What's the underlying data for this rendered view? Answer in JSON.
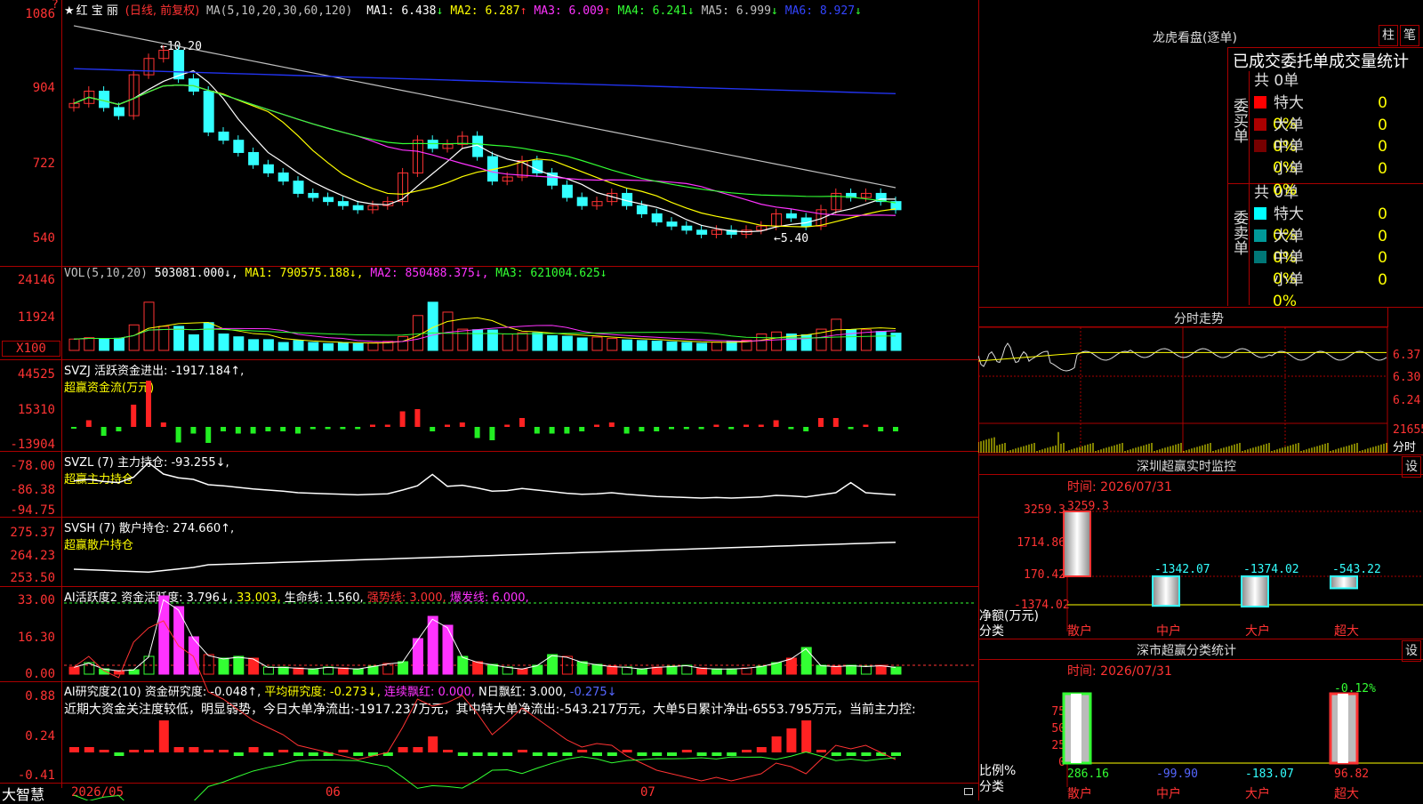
{
  "stock": {
    "star": "★",
    "name": "红 宝 丽",
    "period": "(日线, 前复权)"
  },
  "ma_header": {
    "label": "MA(5,10,20,30,60,120)",
    "items": [
      {
        "k": "MA1:",
        "v": "6.438",
        "a": "↓",
        "c": "#ffffff"
      },
      {
        "k": "MA2:",
        "v": "6.287",
        "a": "↑",
        "c": "#ffff00"
      },
      {
        "k": "MA3:",
        "v": "6.009",
        "a": "↑",
        "c": "#ff33ff"
      },
      {
        "k": "MA4:",
        "v": "6.241",
        "a": "↓",
        "c": "#33ff33"
      },
      {
        "k": "MA5:",
        "v": "6.999",
        "a": "↓",
        "c": "#c0c0c0"
      },
      {
        "k": "MA6:",
        "v": "8.927",
        "a": "↓",
        "c": "#3344ff"
      }
    ]
  },
  "price_axis": [
    "1086",
    "904",
    "722",
    "540"
  ],
  "annotations": {
    "high": "←10.20",
    "low": "←5.40"
  },
  "vol_header": {
    "label": "VOL(5,10,20)",
    "value": "503081.000↓,",
    "ma1": "MA1: 790575.188↓,",
    "ma2": "MA2: 850488.375↓,",
    "ma3": "MA3: 621004.625↓"
  },
  "vol_axis": [
    "24146",
    "11924",
    "X100"
  ],
  "svzj": {
    "title": "SVZJ  活跃资金进出: -1917.184↑,",
    "sub": "超赢资金流(万元)",
    "axis": [
      "44525",
      "15310",
      "-13904"
    ]
  },
  "svzl": {
    "title": "SVZL (7) 主力持仓: -93.255↓,",
    "sub": "超赢主力持仓",
    "axis": [
      "-78.00",
      "-86.38",
      "-94.75"
    ]
  },
  "svsh": {
    "title": "SVSH (7) 散户持仓: 274.660↑,",
    "sub": "超赢散户持仓",
    "axis": [
      "275.37",
      "264.23",
      "253.50"
    ]
  },
  "ai1": {
    "t1": "AI活跃度2 资金活跃度: 3.796↓,",
    "t2": "33.003,",
    "t3": "生命线: 1.560,",
    "t4": "强势线: 3.000,",
    "t5": "爆发线: 6.000,",
    "axis": [
      "33.00",
      "16.30",
      "0.00"
    ]
  },
  "ai2": {
    "t1": "AI研究度2(10) 资金研究度: -0.048↑,",
    "t2": "平均研究度: -0.273↓,",
    "t3": "连续飘红: 0.000,",
    "t4": "N日飘红: 3.000,",
    "t5": "-0.275↓",
    "comment": "近期大资金关注度较低，明显弱势，今日大单净流出:-1917.237万元，其中特大单净流出:-543.217万元，大单5日累计净出-6553.795万元，当前主力控:",
    "axis": [
      "0.88",
      "0.24",
      "-0.41"
    ]
  },
  "bottom": {
    "brand": "大智慧",
    "dates": [
      "2026/05",
      "06",
      "07"
    ]
  },
  "dragon": {
    "title": "龙虎看盘(逐单)",
    "btn1": "柱",
    "btn2": "笔",
    "header": "已成交委托单成交量统计",
    "buy": {
      "side": "委买单",
      "total": "共 0单",
      "rows": [
        {
          "label": "特大",
          "vol": "0",
          "pct": "0%",
          "color": "#ff0000"
        },
        {
          "label": "大单",
          "vol": "0",
          "pct": "0%",
          "color": "#aa0000"
        },
        {
          "label": "中单",
          "vol": "0",
          "pct": "0%",
          "color": "#770000"
        },
        {
          "label": "小单",
          "vol": "0",
          "pct": "0%",
          "color": ""
        }
      ]
    },
    "sell": {
      "side": "委卖单",
      "total": "共 0单",
      "rows": [
        {
          "label": "特大",
          "vol": "0",
          "pct": "0%",
          "color": "#00ffff"
        },
        {
          "label": "大单",
          "vol": "0",
          "pct": "0%",
          "color": "#009999"
        },
        {
          "label": "中单",
          "vol": "0",
          "pct": "0%",
          "color": "#007777"
        },
        {
          "label": "小单",
          "vol": "0",
          "pct": "0%",
          "color": ""
        }
      ]
    }
  },
  "intraday": {
    "title": "分时走势",
    "axis": [
      "6.37",
      "6.30",
      "6.24"
    ],
    "vol_label": "21655",
    "vol_unit": "分时"
  },
  "monitor": {
    "title": "深圳超赢实时监控",
    "btn": "设",
    "time": "时间: 2026/07/31",
    "axis": [
      "3259.3",
      "1714.86",
      "170.42",
      "-1374.02"
    ],
    "unit": "净额(万元)",
    "cat_label": "分类",
    "bars": [
      {
        "cat": "散户",
        "value": "3259.3"
      },
      {
        "cat": "中户",
        "value": "-1342.07"
      },
      {
        "cat": "大户",
        "value": "-1374.02"
      },
      {
        "cat": "超大",
        "value": "-543.22"
      }
    ]
  },
  "classify": {
    "title": "深市超赢分类统计",
    "btn": "设",
    "time": "时间: 2026/07/31",
    "axis": [
      "75",
      "50",
      "25",
      "0"
    ],
    "unit": "比例%",
    "cat_label": "分类",
    "top_label": "-0.12%",
    "bars": [
      {
        "cat": "散户",
        "value": "286.16"
      },
      {
        "cat": "中户",
        "value": "-99.90"
      },
      {
        "cat": "大户",
        "value": "-183.07"
      },
      {
        "cat": "超大",
        "value": "96.82"
      }
    ]
  },
  "chart_data": [
    {
      "type": "candlestick",
      "title": "红宝丽 日线 前复权",
      "y_axis_ticks": [
        10.86,
        9.04,
        7.22,
        5.4
      ],
      "high": 10.2,
      "low": 5.4,
      "close": [
        8.7,
        9.0,
        8.6,
        8.4,
        9.4,
        9.8,
        10.0,
        9.3,
        9.0,
        8.0,
        7.8,
        7.5,
        7.2,
        7.0,
        6.8,
        6.5,
        6.4,
        6.3,
        6.2,
        6.1,
        6.2,
        6.3,
        7.0,
        7.8,
        7.6,
        7.7,
        7.9,
        7.4,
        6.8,
        6.9,
        7.3,
        7.0,
        6.7,
        6.4,
        6.2,
        6.3,
        6.5,
        6.2,
        6.0,
        5.8,
        5.7,
        5.6,
        5.5,
        5.6,
        5.5,
        5.6,
        5.7,
        6.0,
        5.9,
        5.7,
        6.1,
        6.5,
        6.4,
        6.5,
        6.3,
        6.1
      ],
      "ma": [
        {
          "name": "MA1",
          "value": 6.438
        },
        {
          "name": "MA2",
          "value": 6.287
        },
        {
          "name": "MA3",
          "value": 6.009
        },
        {
          "name": "MA4",
          "value": 6.241
        },
        {
          "name": "MA5",
          "value": 6.999
        },
        {
          "name": "MA6",
          "value": 8.927
        }
      ]
    },
    {
      "type": "bar",
      "title": "VOL(5,10,20)",
      "unit": "X100",
      "y_axis_ticks": [
        24146,
        11924
      ],
      "values": [
        4000,
        4500,
        4200,
        4300,
        9000,
        17000,
        8500,
        8500,
        5500,
        9800,
        5800,
        4800,
        3800,
        3800,
        2800,
        3500,
        2800,
        2400,
        2700,
        2400,
        2700,
        3200,
        4900,
        12300,
        17000,
        13500,
        7500,
        7300,
        7200,
        5800,
        6200,
        6200,
        5200,
        5000,
        4400,
        4700,
        4200,
        3700,
        3500,
        3300,
        3000,
        2800,
        2500,
        2900,
        3200,
        3600,
        5800,
        6500,
        5800,
        5500,
        7500,
        11000,
        7300,
        7300,
        6700,
        6100,
        4000
      ],
      "ma": [
        {
          "name": "MA1",
          "value": 790575.188
        },
        {
          "name": "MA2",
          "value": 850488.375
        },
        {
          "name": "MA3",
          "value": 621004.625
        }
      ]
    },
    {
      "type": "bar",
      "title": "SVZJ 活跃资金进出",
      "unit": "万元",
      "value": -1917.184,
      "y_axis_ticks": [
        44525,
        15310,
        -13904
      ]
    },
    {
      "type": "line",
      "title": "SVZL (7) 主力持仓",
      "value": -93.255,
      "y_axis_ticks": [
        -78.0,
        -86.38,
        -94.75
      ]
    },
    {
      "type": "line",
      "title": "SVSH (7) 散户持仓",
      "value": 274.66,
      "y_axis_ticks": [
        275.37,
        264.23,
        253.5
      ]
    },
    {
      "type": "bar",
      "title": "AI活跃度2 资金活跃度",
      "value": 3.796,
      "y_axis_ticks": [
        33.0,
        16.3,
        0.0
      ]
    },
    {
      "type": "bar",
      "title": "AI研究度2(10) 资金研究度",
      "value": -0.048,
      "y_axis_ticks": [
        0.88,
        0.24,
        -0.41
      ]
    },
    {
      "type": "bar",
      "title": "深圳超赢实时监控",
      "ylabel": "净额(万元)",
      "categories": [
        "散户",
        "中户",
        "大户",
        "超大"
      ],
      "values": [
        3259.3,
        -1342.07,
        -1374.02,
        -543.22
      ]
    },
    {
      "type": "bar",
      "title": "深市超赢分类统计",
      "ylabel": "比例%",
      "categories": [
        "散户",
        "中户",
        "大户",
        "超大"
      ],
      "values": [
        286.16,
        -99.9,
        -183.07,
        96.82
      ]
    }
  ]
}
